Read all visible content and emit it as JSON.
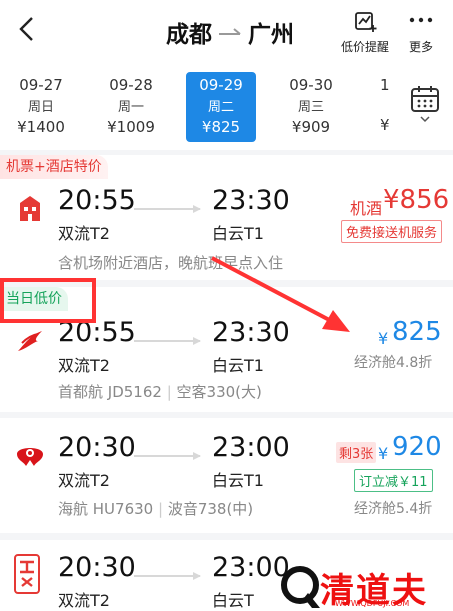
{
  "header": {
    "origin": "成都",
    "destination": "广州",
    "low_price_label": "低价提醒",
    "more_label": "更多"
  },
  "dates": [
    {
      "date": "09-27",
      "weekday": "周日",
      "price": "¥1400",
      "selected": false
    },
    {
      "date": "09-28",
      "weekday": "周一",
      "price": "¥1009",
      "selected": false
    },
    {
      "date": "09-29",
      "weekday": "周二",
      "price": "¥825",
      "selected": true
    },
    {
      "date": "09-30",
      "weekday": "周三",
      "price": "¥909",
      "selected": false
    },
    {
      "date": "1",
      "weekday": "",
      "price": "¥",
      "selected": false
    }
  ],
  "flights": [
    {
      "tag": "机票+酒店特价",
      "dep_time": "20:55",
      "dep_airport": "双流T2",
      "arr_time": "23:30",
      "arr_airport": "白云T1",
      "price_prefix": "机酒",
      "price": "¥856",
      "badge": "免费接送机服务",
      "note": "含机场附近酒店，晚航班早点入住"
    },
    {
      "tag": "当日低价",
      "dep_time": "20:55",
      "dep_airport": "双流T2",
      "arr_time": "23:30",
      "arr_airport": "白云T1",
      "price_symbol": "¥",
      "price": "825",
      "cabin": "经济舱4.8折",
      "airline": "首都航 JD5162",
      "aircraft": "空客330(大)"
    },
    {
      "dep_time": "20:30",
      "dep_airport": "双流T2",
      "arr_time": "23:00",
      "arr_airport": "白云T1",
      "remaining": "剩3张",
      "price_symbol": "¥",
      "price": "920",
      "discount": "订立减￥11",
      "cabin": "经济舱5.4折",
      "airline": "海航 HU7630",
      "aircraft": "波音738(中)"
    },
    {
      "dep_time": "20:30",
      "dep_airport": "双流T2",
      "arr_time": "23:00",
      "arr_airport": "白云T"
    }
  ],
  "watermark": {
    "text": "清道夫",
    "url": "WWW.QDFUJI.COM"
  },
  "colors": {
    "accent_blue": "#1e88e5",
    "price_red": "#e53935",
    "green": "#15a35a",
    "annotation_red": "#ff3333"
  }
}
